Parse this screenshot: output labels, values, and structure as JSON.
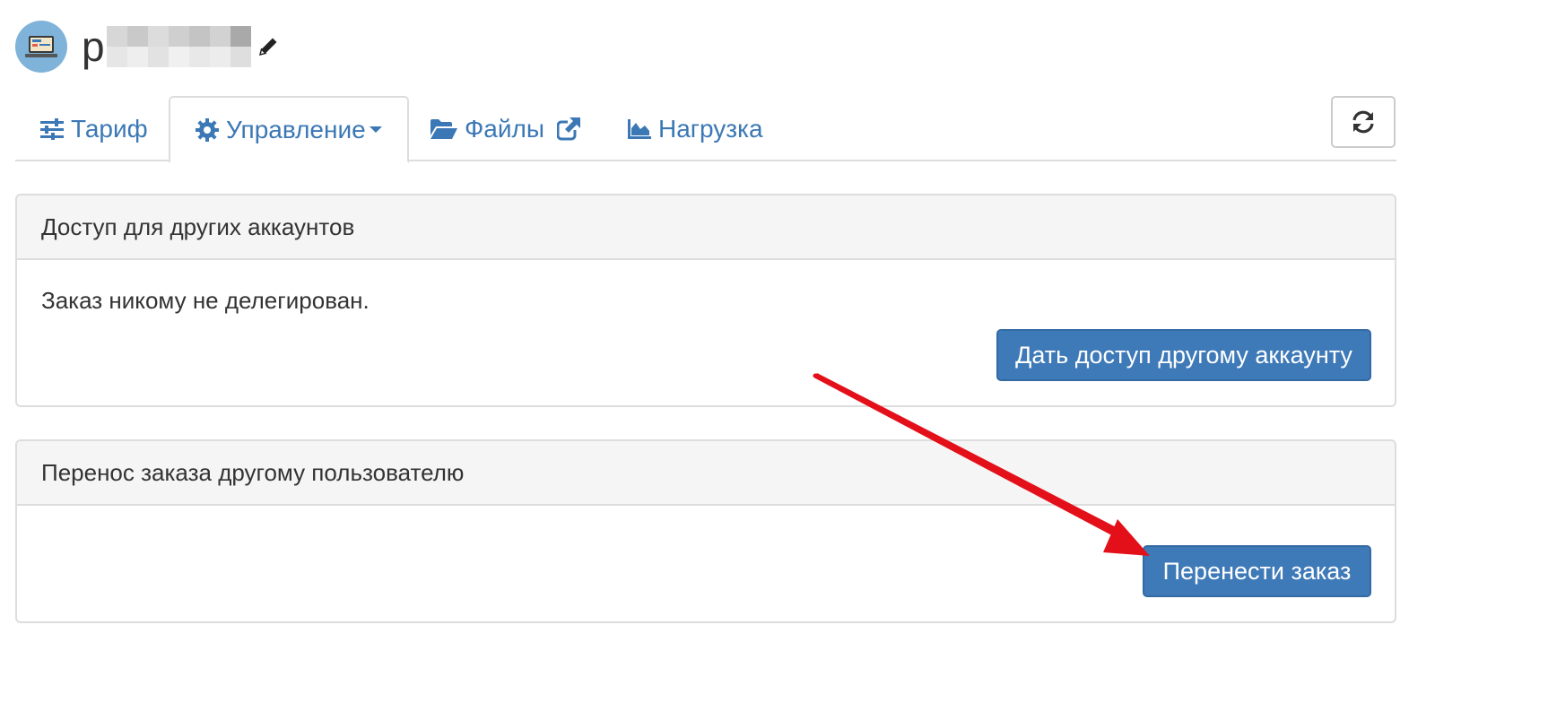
{
  "header": {
    "title_visible": "p",
    "avatar_icon": "laptop-icon",
    "edit_icon": "pencil-icon"
  },
  "tabs": [
    {
      "label": "Тариф",
      "icon": "sliders-icon"
    },
    {
      "label": "Управление",
      "icon": "gear-icon",
      "active": true,
      "dropdown": true
    },
    {
      "label": "Файлы",
      "icon": "folder-open-icon",
      "external": true
    },
    {
      "label": "Нагрузка",
      "icon": "area-chart-icon"
    }
  ],
  "refresh_icon": "refresh-icon",
  "access_panel": {
    "heading": "Доступ для других аккаунтов",
    "status": "Заказ никому не делегирован.",
    "button_label": "Дать доступ другому аккаунту"
  },
  "transfer_panel": {
    "heading": "Перенос заказа другому пользователю",
    "button_label": "Перенести заказ"
  },
  "colors": {
    "link": "#3b78b5",
    "primary_button": "#3f7ab8",
    "annotation_arrow": "#e3101a"
  }
}
